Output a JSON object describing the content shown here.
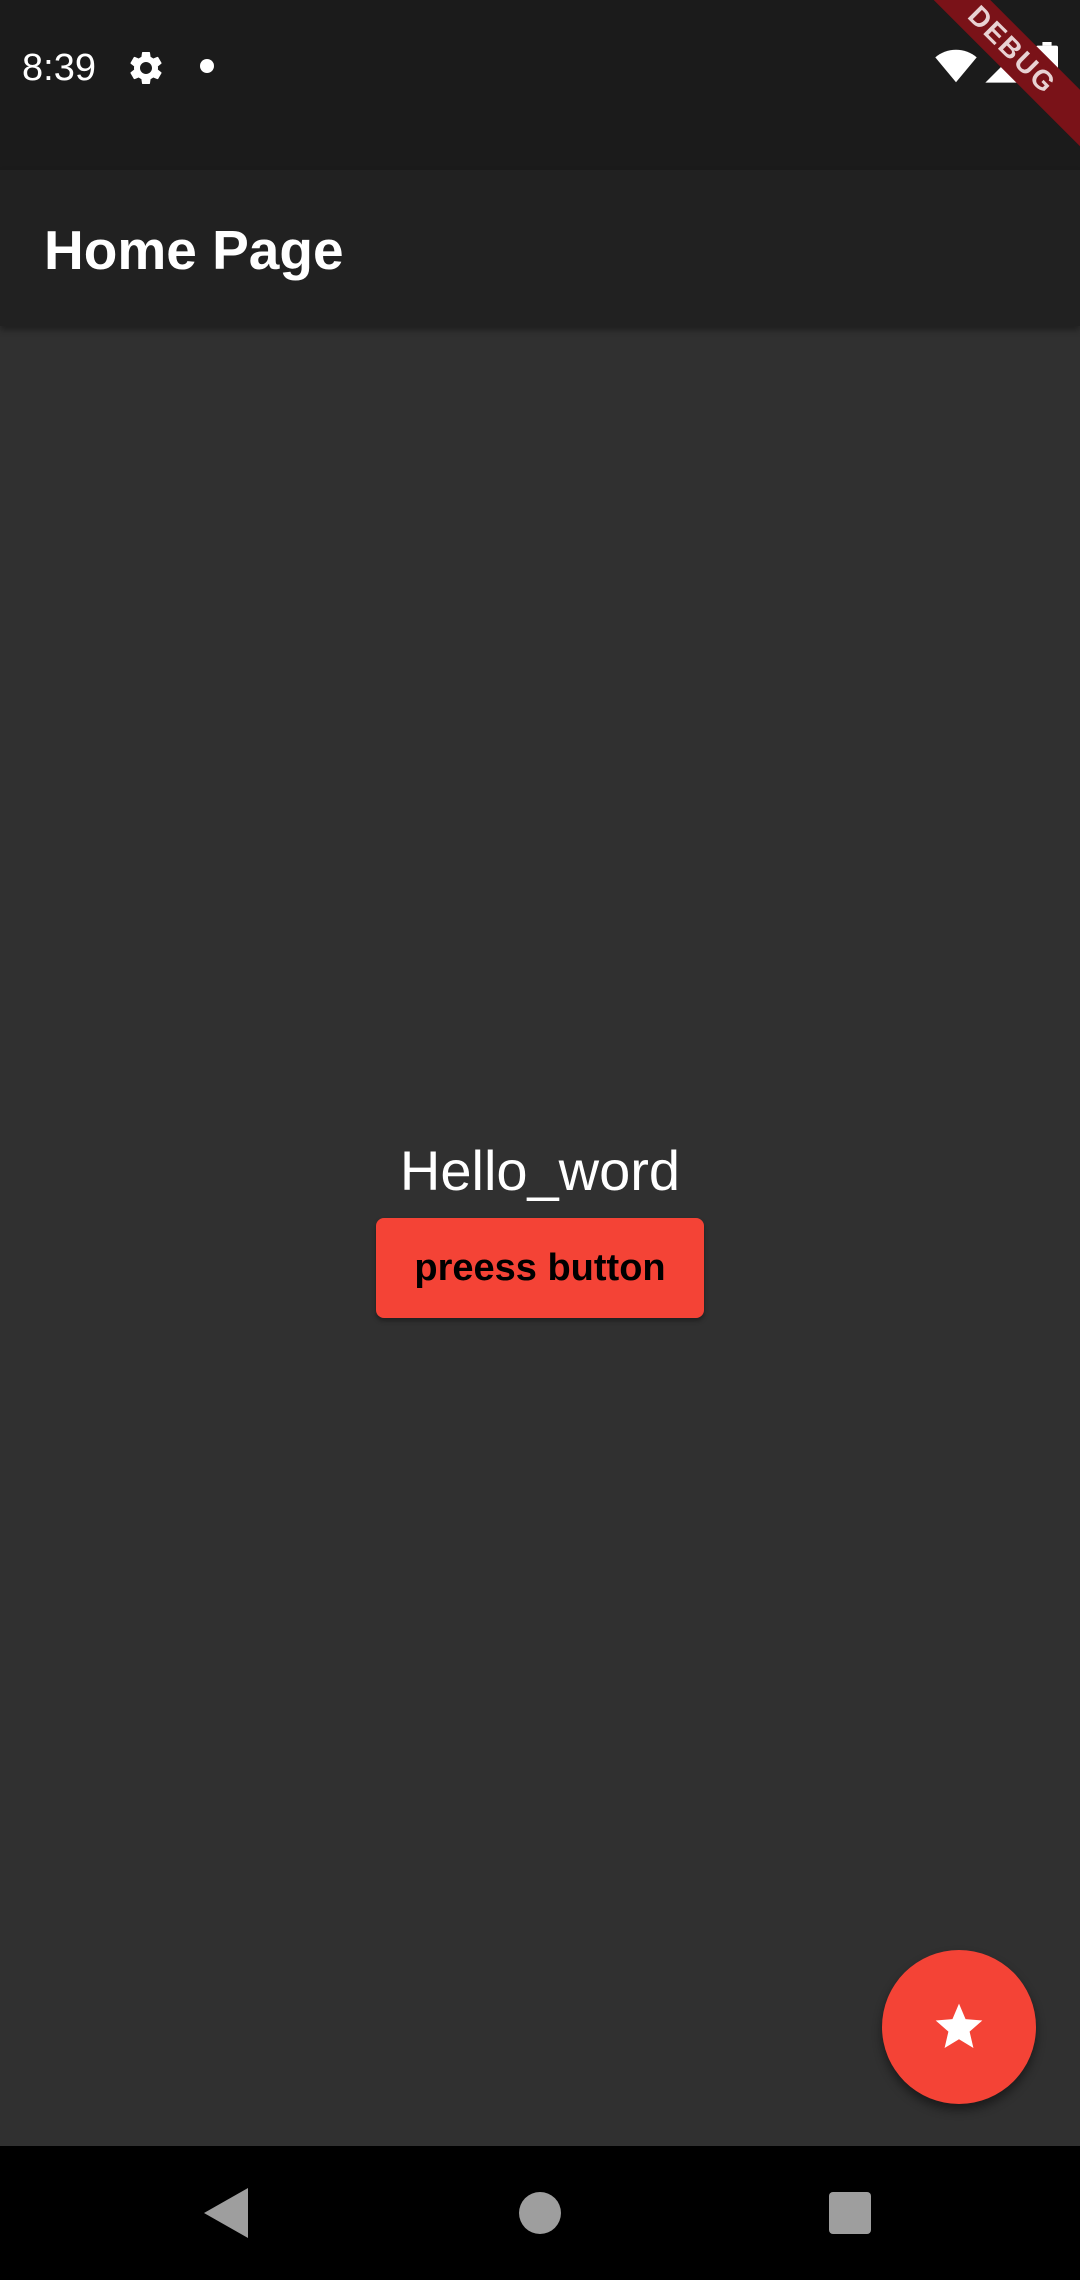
{
  "status_bar": {
    "time": "8:39",
    "icons": [
      "gear-icon",
      "notification-dot-icon",
      "wifi-icon",
      "signal-icon",
      "battery-icon"
    ]
  },
  "debug_banner": {
    "label": "DEBUG"
  },
  "app_bar": {
    "title": "Home Page"
  },
  "main": {
    "text": "Hello_word",
    "button_label": "preess button"
  },
  "fab": {
    "icon": "star-icon"
  },
  "nav_bar": {
    "icons": [
      "back-icon",
      "home-icon",
      "recents-icon"
    ]
  },
  "colors": {
    "accent": "#f44336",
    "background": "#303030",
    "app_bar": "#212121",
    "status_bar": "#1b1b1b",
    "debug_banner": "#7a1218"
  }
}
